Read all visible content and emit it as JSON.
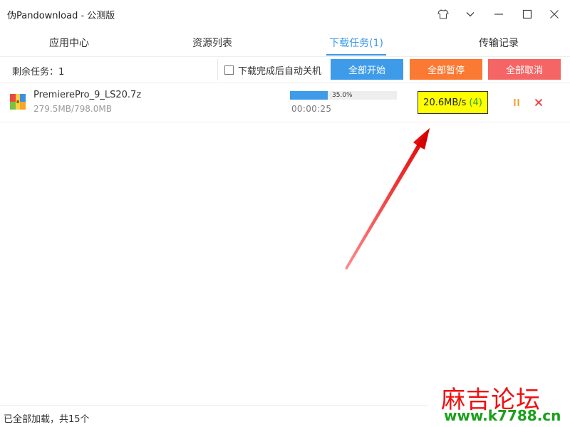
{
  "window": {
    "title": "伪Pandownload - 公测版",
    "controls": {
      "skin_icon": "tshirt-icon",
      "menu_icon": "chevron-down-icon",
      "minimize_icon": "minimize-icon",
      "maximize_icon": "maximize-icon",
      "close_icon": "close-icon"
    }
  },
  "tabs": [
    {
      "label": "应用中心",
      "active": false
    },
    {
      "label": "资源列表",
      "active": false
    },
    {
      "label": "下载任务(1)",
      "active": true
    },
    {
      "label": "传输记录",
      "active": false
    }
  ],
  "toolbar": {
    "remaining_tasks": "剩余任务：1",
    "auto_shutdown_label": "下载完成后自动关机",
    "auto_shutdown_checked": false,
    "start_all": "全部开始",
    "pause_all": "全部暂停",
    "cancel_all": "全部取消"
  },
  "downloads": [
    {
      "file_icon": "archive-icon",
      "name": "PremierePro_9_LS20.7z",
      "size": "279.5MB/798.0MB",
      "progress": 0.35,
      "progress_label": "35.0%",
      "elapsed": "00:00:25",
      "speed": "20.6MB/s",
      "threads": "(4)",
      "pause_icon": "pause-icon",
      "cancel_icon": "close-icon"
    }
  ],
  "statusbar": {
    "text": "已全部加载，共15个"
  },
  "watermark": {
    "title": "麻吉论坛",
    "url": "www.k7788.cn"
  },
  "colors": {
    "accent": "#3a98e8",
    "start_button": "#3e9be9",
    "pause_button": "#fb7a33",
    "cancel_button": "#f56566",
    "highlight": "#ffff00",
    "annotation_arrow": "#e00000",
    "watermark_red": "#ee1111",
    "watermark_green": "#1aa01a"
  }
}
